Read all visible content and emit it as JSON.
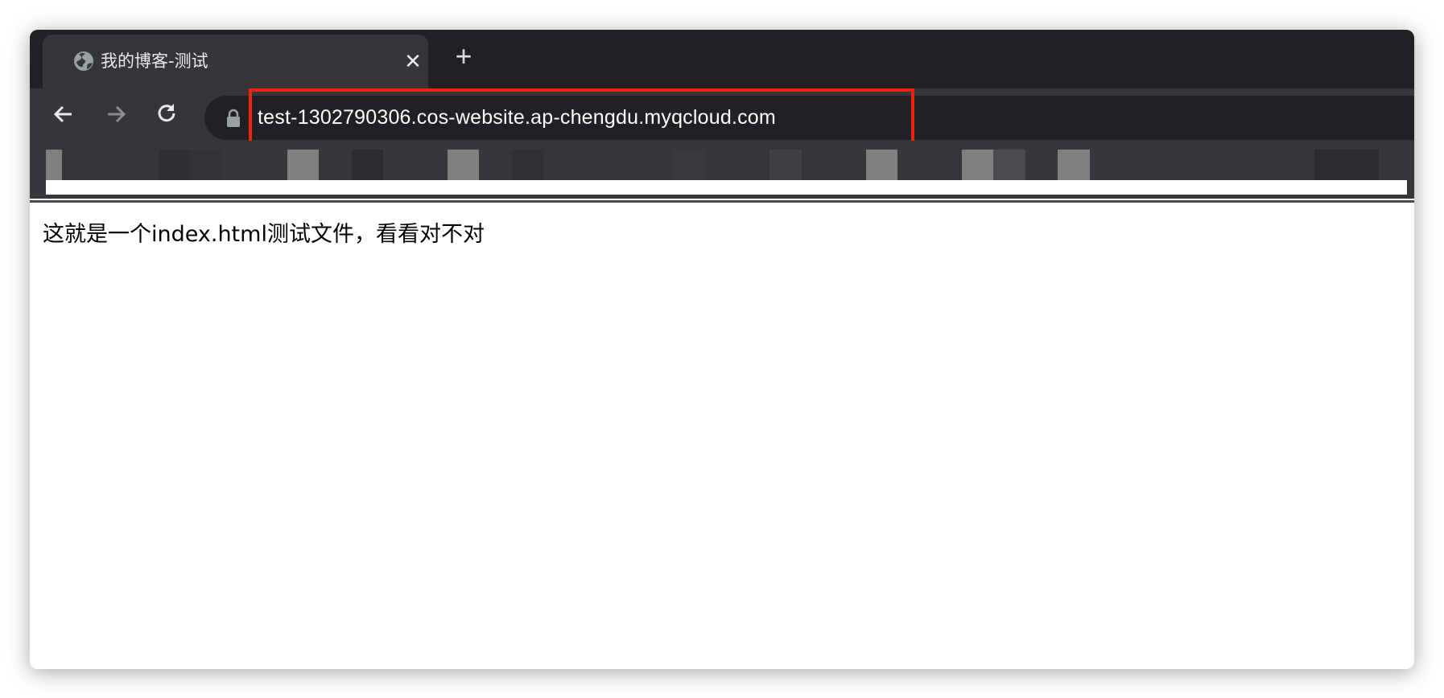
{
  "browser": {
    "tab": {
      "title": "我的博客-测试",
      "favicon": "globe-icon",
      "close_icon": "close-icon",
      "close_glyph": "✕"
    },
    "new_tab": {
      "icon": "plus-icon",
      "glyph": "+"
    },
    "nav": {
      "back_icon": "arrow-left-icon",
      "forward_icon": "arrow-right-icon",
      "reload_icon": "reload-icon"
    },
    "address_bar": {
      "security_icon": "lock-icon",
      "url": "test-1302790306.cos-website.ap-chengdu.myqcloud.com"
    },
    "highlight_color": "#f0230e"
  },
  "page": {
    "text": "这就是一个index.html测试文件，看看对不对"
  }
}
